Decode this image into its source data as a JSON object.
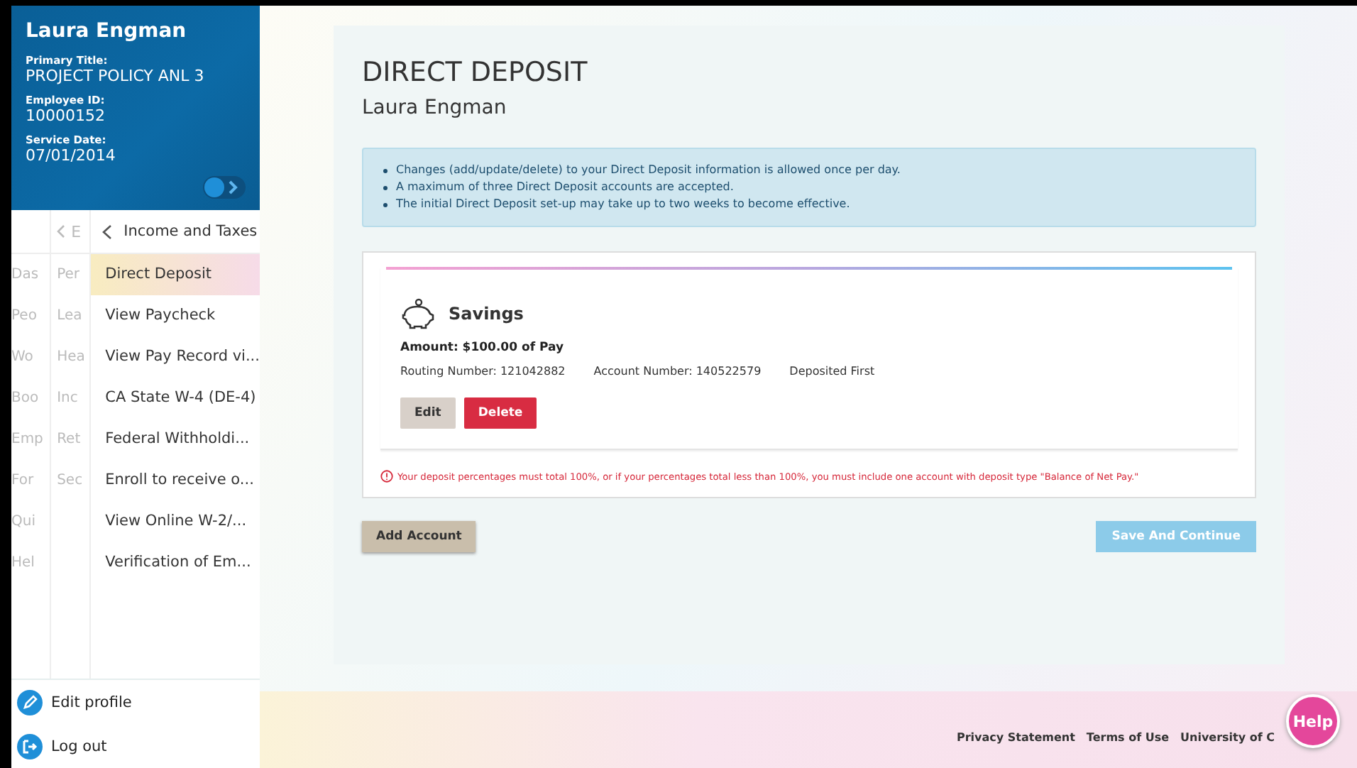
{
  "profile": {
    "name": "Laura Engman",
    "expanded": true,
    "fields": [
      {
        "label": "Primary Title:",
        "value": "PROJECT POLICY ANL 3"
      },
      {
        "label": "Employee ID:",
        "value": "10000152"
      },
      {
        "label": "Service Date:",
        "value": "07/01/2014"
      }
    ]
  },
  "nav_level_1": [
    "Das",
    "Peo",
    "Wo",
    "Boo",
    "Emp",
    "For",
    "Qui",
    "Hel"
  ],
  "nav_level_2": {
    "header": "E",
    "items": [
      "Per",
      "Lea",
      "Hea",
      "Inc",
      "Ret",
      "Sec"
    ]
  },
  "nav_level_3": {
    "header": "Income and Taxes",
    "items": [
      {
        "label": "Direct Deposit",
        "selected": true
      },
      {
        "label": "View Paycheck",
        "selected": false
      },
      {
        "label": "View Pay Record vi...",
        "selected": false
      },
      {
        "label": "CA State W-4 (DE-4)",
        "selected": false
      },
      {
        "label": "Federal Withholdi...",
        "selected": false
      },
      {
        "label": "Enroll to receive o...",
        "selected": false
      },
      {
        "label": "View Online W-2/...",
        "selected": false
      },
      {
        "label": "Verification of Em...",
        "selected": false
      }
    ]
  },
  "sidebar_actions": [
    {
      "kind": "edit",
      "label": "Edit profile"
    },
    {
      "kind": "logout",
      "label": "Log out"
    }
  ],
  "page": {
    "title": "DIRECT DEPOSIT",
    "subtitle": "Laura Engman",
    "notices": [
      "Changes (add/update/delete) to your Direct Deposit information is allowed once per day.",
      "A maximum of three Direct Deposit accounts are accepted.",
      "The initial Direct Deposit set-up may take up to two weeks to become effective."
    ],
    "account": {
      "type": "Savings",
      "amount": "Amount: $100.00 of Pay",
      "routing": "Routing Number: 121042882",
      "account_number": "Account Number: 140522579",
      "order": "Deposited First",
      "buttons": [
        "Edit",
        "Delete"
      ]
    },
    "warning": "Your deposit percentages must total 100%, or if your percentages total less than 100%, you must include one account with deposit type \"Balance of Net Pay.\"",
    "add_button": "Add Account",
    "save_button": "Save And Continue"
  },
  "footer_links": [
    "Privacy Statement",
    "Terms of Use",
    "University of C"
  ],
  "help_button": "Help"
}
